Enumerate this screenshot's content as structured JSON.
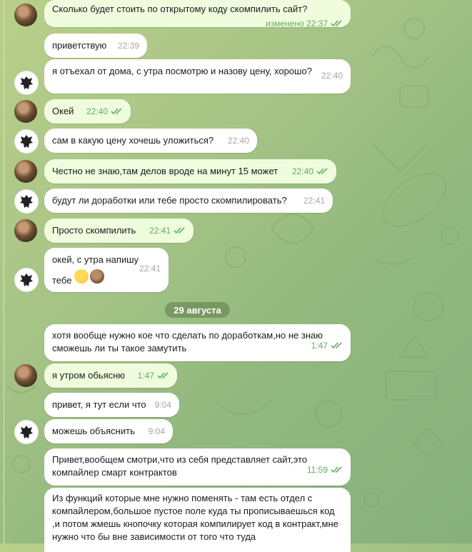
{
  "chat": {
    "date_separator": "29 августа",
    "messages": [
      {
        "dir": "out",
        "text": "Сколько будет стоить по открытому коду скомпилить сайт?",
        "time": "изменено 22:37",
        "read": true
      },
      {
        "dir": "in",
        "text": "приветствую",
        "time": "22:39"
      },
      {
        "dir": "in",
        "text": "я отъехал от дома, с утра посмотрю и назову цену, хорошо?",
        "time": "22:40"
      },
      {
        "dir": "out",
        "text": "Окей",
        "time": "22:40",
        "read": true
      },
      {
        "dir": "in",
        "text": "сам в какую цену хочешь уложиться?",
        "time": "22:40"
      },
      {
        "dir": "out",
        "text": "Честно не знаю,там делов вроде на минут 15 может",
        "time": "22:40",
        "read": true
      },
      {
        "dir": "in",
        "text": "будут ли доработки или тебе просто скомпилировать?",
        "time": "22:41"
      },
      {
        "dir": "out",
        "text": "Просто скомпилить",
        "time": "22:41",
        "read": true
      },
      {
        "dir": "in",
        "text": "окей, с утра напишу тебе",
        "time": "22:41",
        "reactions": [
          "thumbs-up",
          "avatar"
        ]
      },
      {
        "dir": "in",
        "text": "хотя вообще нужно кое что сделать по доработкам,но не знаю сможешь ли ты такое замутить",
        "time": "1:47",
        "read": true
      },
      {
        "dir": "out",
        "text": "я утром обьясню",
        "time": "1:47",
        "read": true
      },
      {
        "dir": "in",
        "text": "привет, я тут если что",
        "time": "9:04"
      },
      {
        "dir": "in",
        "text": "можешь объяснить",
        "time": "9:04"
      },
      {
        "dir": "in",
        "text": "Привет,вообщем смотри,что из себя представляет сайт,это компайлер смарт контрактов",
        "time": "11:59",
        "read": true
      },
      {
        "dir": "in",
        "text": "Из функций которые мне нужно поменять - там есть отдел с компайлером,большое пустое поле куда ты прописываешься код ,и потом жмешь кнопочку которая компилирует код в контракт,мне нужно что бы вне зависимости от того что туда"
      }
    ]
  },
  "colors": {
    "bubble_in": "#ffffff",
    "bubble_out": "#effdde",
    "check": "#5fae5c",
    "meta": "#a6a6a6"
  }
}
